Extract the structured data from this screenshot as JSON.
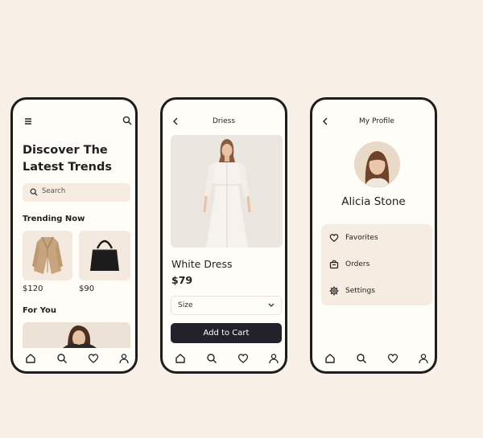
{
  "screens": {
    "home": {
      "title_line1": "Discover The",
      "title_line2": "Latest Trends",
      "search_placeholder": "Search",
      "trending_heading": "Trending Now",
      "trending_items": [
        {
          "icon": "coat-image",
          "price": "$120"
        },
        {
          "icon": "handbag-image",
          "price": "$90"
        }
      ],
      "for_you_heading": "For You"
    },
    "product": {
      "header_title": "Driess",
      "name": "White Dress",
      "price": "$79",
      "size_label": "Size",
      "cart_button": "Add to Cart"
    },
    "profile": {
      "header_title": "My Profile",
      "user_name": "Alicia Stone",
      "menu": [
        "Favorites",
        "Orders",
        "Settings"
      ]
    }
  },
  "nav_icons": [
    "home-icon",
    "search-icon",
    "heart-icon",
    "user-icon"
  ],
  "colors": {
    "background": "#f8efe6",
    "screen": "#fffdf8",
    "card": "#f6ece1",
    "button": "#22222a",
    "text": "#1f1f1f"
  }
}
